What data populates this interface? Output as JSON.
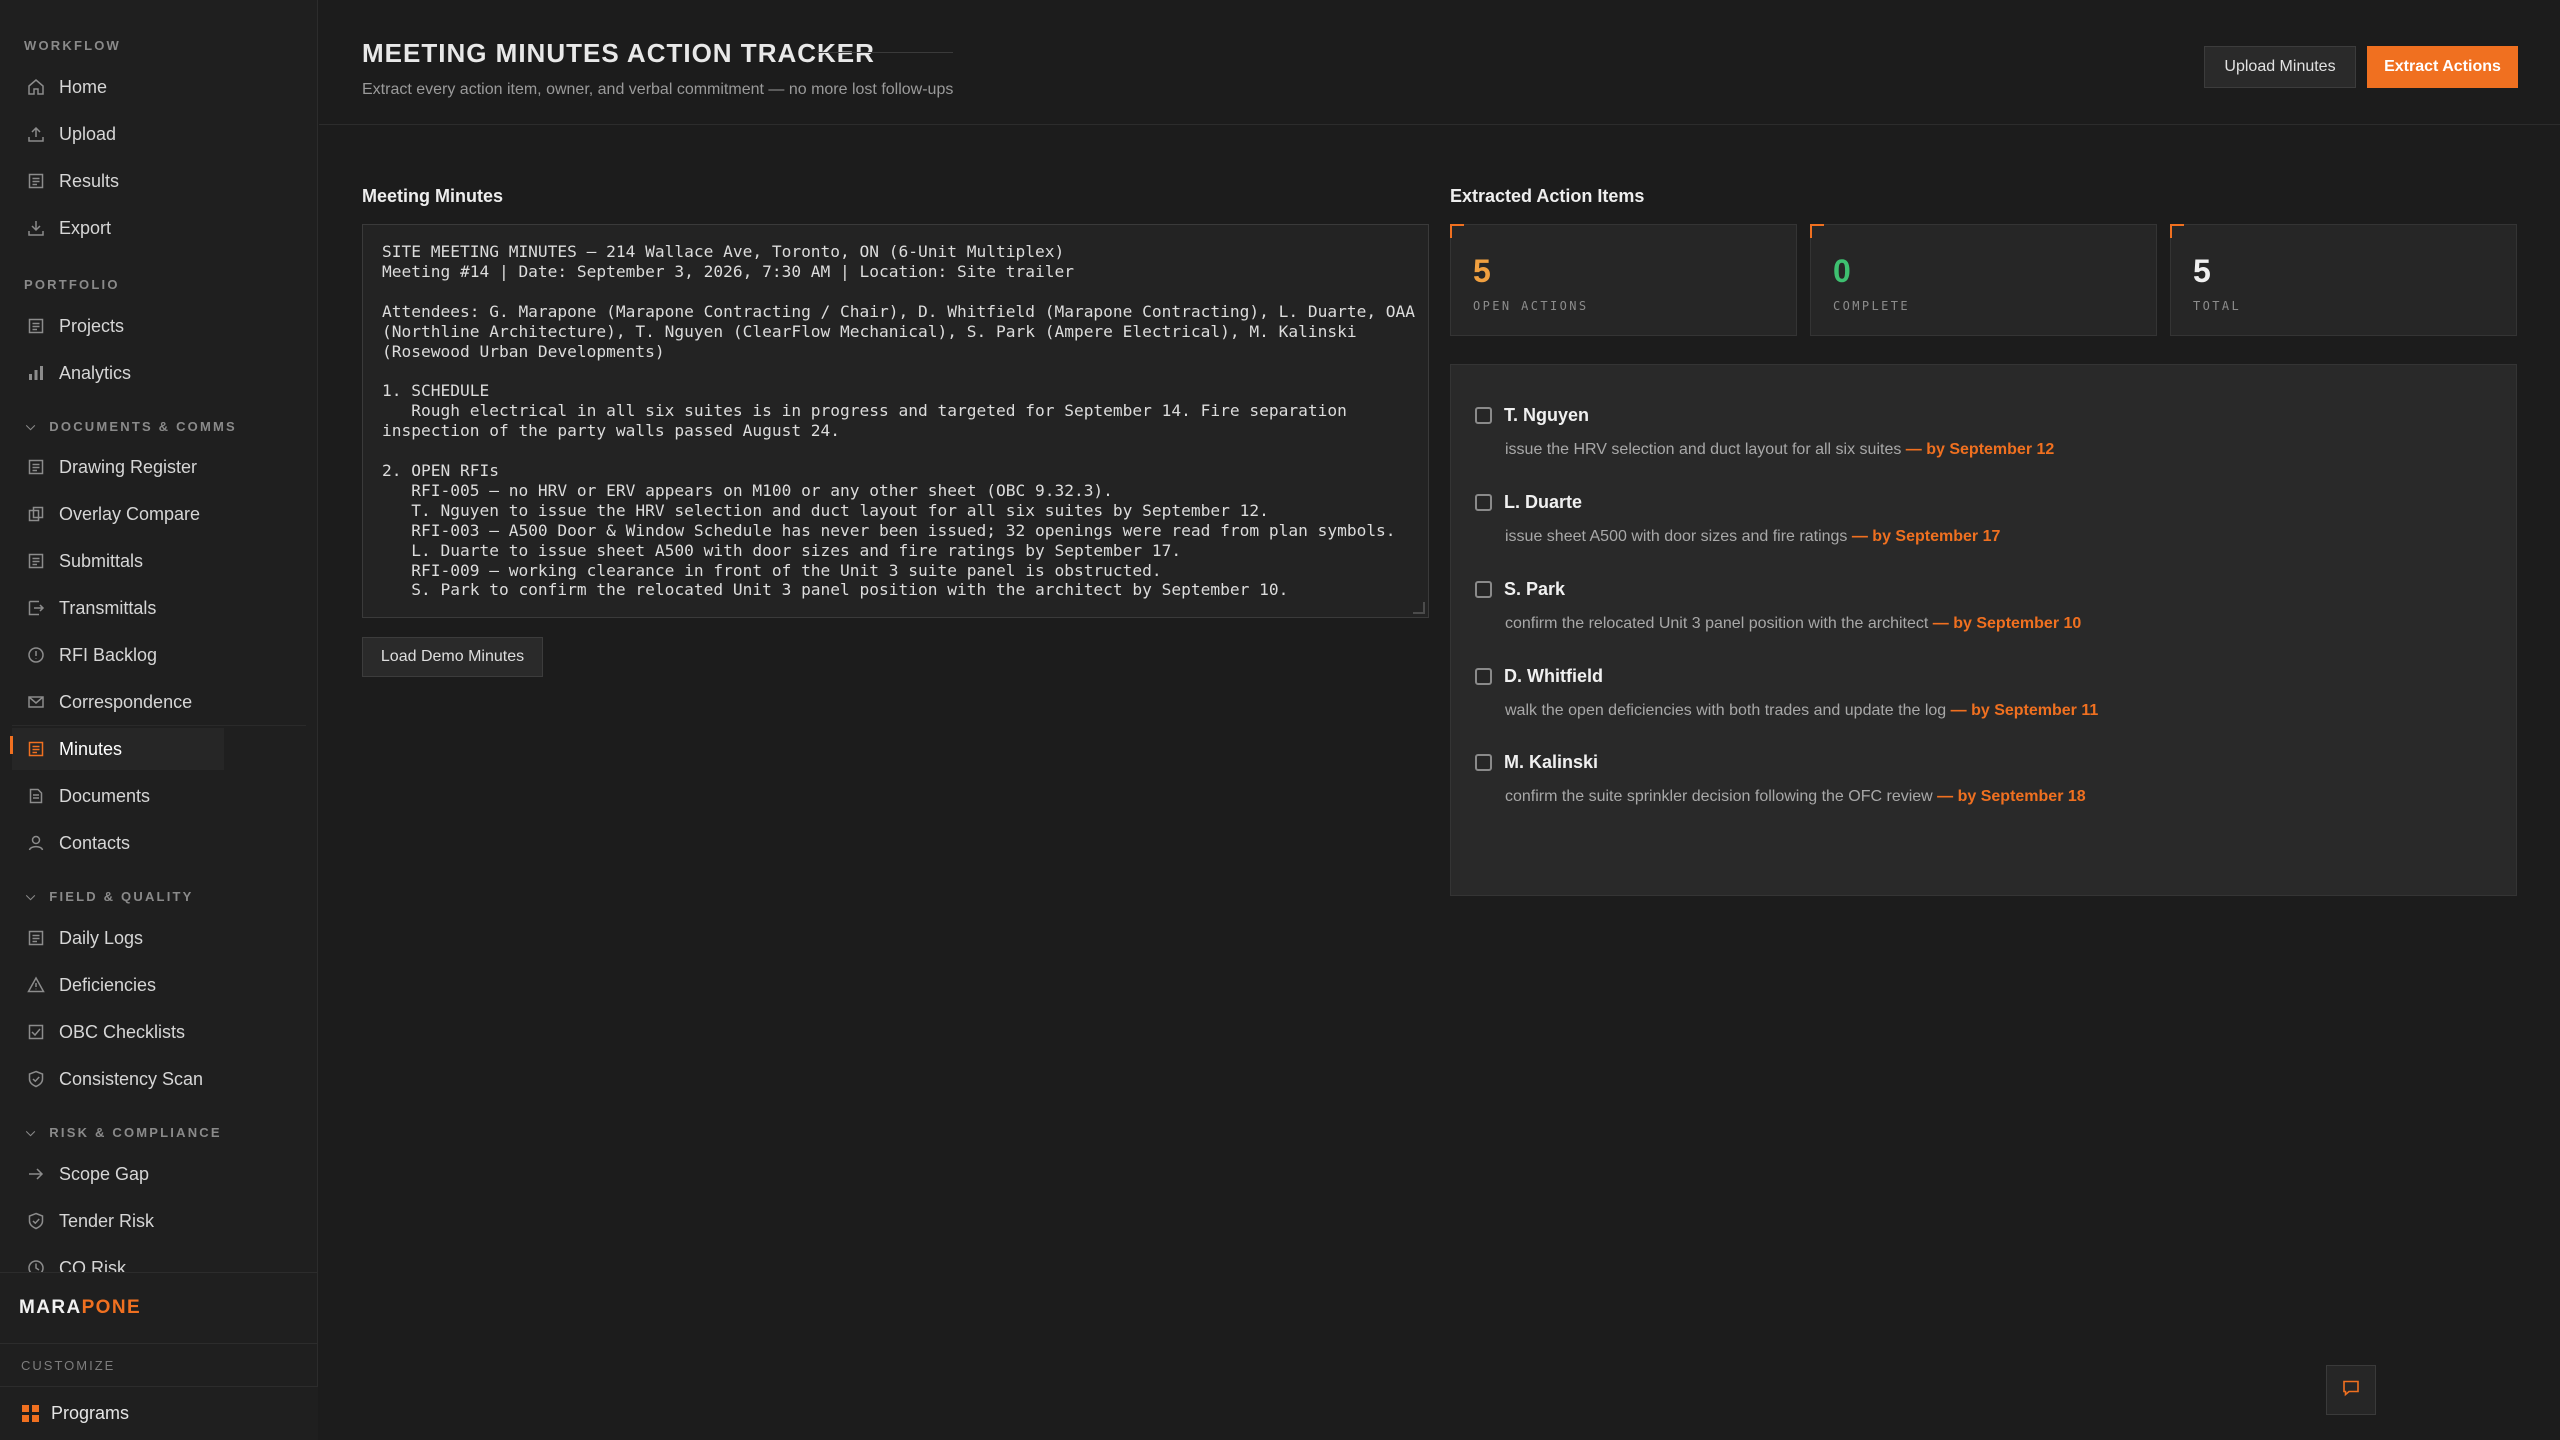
{
  "sidebar": {
    "sections": {
      "workflow": "WORKFLOW",
      "portfolio": "PORTFOLIO",
      "documents": "DOCUMENTS & COMMS",
      "field": "FIELD & QUALITY",
      "risk": "RISK & COMPLIANCE"
    },
    "items": {
      "home": "Home",
      "upload": "Upload",
      "results": "Results",
      "export": "Export",
      "projects": "Projects",
      "analytics": "Analytics",
      "drawing_register": "Drawing Register",
      "overlay_compare": "Overlay Compare",
      "submittals": "Submittals",
      "transmittals": "Transmittals",
      "rfi_backlog": "RFI Backlog",
      "correspondence": "Correspondence",
      "minutes": "Minutes",
      "documents": "Documents",
      "contacts": "Contacts",
      "daily_logs": "Daily Logs",
      "deficiencies": "Deficiencies",
      "obc_checklists": "OBC Checklists",
      "consistency_scan": "Consistency Scan",
      "scope_gap": "Scope Gap",
      "tender_risk": "Tender Risk",
      "co_risk": "CO Risk"
    },
    "active_item": "Minutes",
    "brand_part1": "MARA",
    "brand_part2": "PONE",
    "customize_label": "CUSTOMIZE",
    "programs_label": "Programs",
    "accent_color": "#f07020"
  },
  "header": {
    "title": "MEETING MINUTES ACTION TRACKER",
    "subtitle": "Extract every action item, owner, and verbal commitment — no more lost follow-ups",
    "upload_button": "Upload Minutes",
    "extract_button": "Extract Actions"
  },
  "minutes": {
    "label": "Meeting Minutes",
    "text": "SITE MEETING MINUTES — 214 Wallace Ave, Toronto, ON (6-Unit Multiplex)\nMeeting #14 | Date: September 3, 2026, 7:30 AM | Location: Site trailer\n\nAttendees: G. Marapone (Marapone Contracting / Chair), D. Whitfield (Marapone Contracting), L. Duarte, OAA\n(Northline Architecture), T. Nguyen (ClearFlow Mechanical), S. Park (Ampere Electrical), M. Kalinski\n(Rosewood Urban Developments)\n\n1. SCHEDULE\n   Rough electrical in all six suites is in progress and targeted for September 14. Fire separation\ninspection of the party walls passed August 24.\n\n2. OPEN RFIs\n   RFI-005 — no HRV or ERV appears on M100 or any other sheet (OBC 9.32.3).\n   T. Nguyen to issue the HRV selection and duct layout for all six suites by September 12.\n   RFI-003 — A500 Door & Window Schedule has never been issued; 32 openings were read from plan symbols.\n   L. Duarte to issue sheet A500 with door sizes and fire ratings by September 17.\n   RFI-009 — working clearance in front of the Unit 3 suite panel is obstructed.\n   S. Park to confirm the relocated Unit 3 panel position with the architect by September 10.",
    "demo_button": "Load Demo Minutes"
  },
  "extracted": {
    "label": "Extracted Action Items",
    "stats": {
      "open": "5",
      "open_label": "OPEN ACTIONS",
      "complete": "0",
      "complete_label": "COMPLETE",
      "total": "5",
      "total_label": "TOTAL"
    },
    "actions": [
      {
        "owner": "T. Nguyen",
        "task": "issue the HRV selection and duct layout for all six suites ",
        "due": "— by September 12"
      },
      {
        "owner": "L. Duarte",
        "task": "issue sheet A500 with door sizes and fire ratings ",
        "due": "— by September 17"
      },
      {
        "owner": "S. Park",
        "task": "confirm the relocated Unit 3 panel position with the architect ",
        "due": "— by September 10"
      },
      {
        "owner": "D. Whitfield",
        "task": "walk the open deficiencies with both trades and update the log ",
        "due": "— by September 11"
      },
      {
        "owner": "M. Kalinski",
        "task": "confirm the suite sprinkler decision following the OFC review ",
        "due": "— by September 18"
      }
    ]
  },
  "colors": {
    "open": "#f0a040",
    "complete": "#3ec070",
    "total": "#f0f0f0"
  }
}
